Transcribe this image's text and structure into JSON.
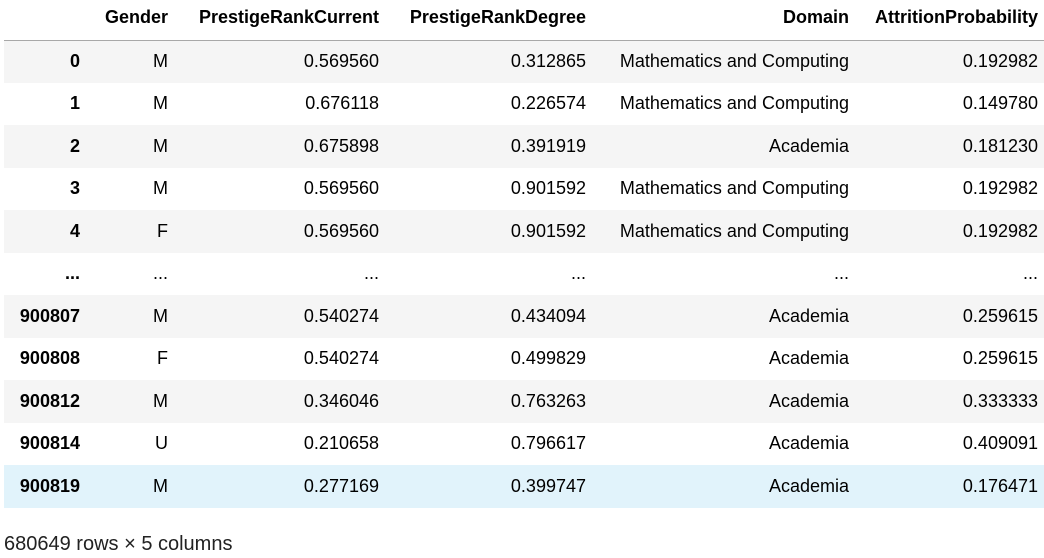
{
  "table": {
    "columns": [
      "",
      "Gender",
      "PrestigeRankCurrent",
      "PrestigeRankDegree",
      "Domain",
      "AttritionProbability"
    ],
    "rows": [
      {
        "index": "0",
        "gender": "M",
        "current": "0.569560",
        "degree": "0.312865",
        "domain": "Mathematics and Computing",
        "attrition": "0.192982"
      },
      {
        "index": "1",
        "gender": "M",
        "current": "0.676118",
        "degree": "0.226574",
        "domain": "Mathematics and Computing",
        "attrition": "0.149780"
      },
      {
        "index": "2",
        "gender": "M",
        "current": "0.675898",
        "degree": "0.391919",
        "domain": "Academia",
        "attrition": "0.181230"
      },
      {
        "index": "3",
        "gender": "M",
        "current": "0.569560",
        "degree": "0.901592",
        "domain": "Mathematics and Computing",
        "attrition": "0.192982"
      },
      {
        "index": "4",
        "gender": "F",
        "current": "0.569560",
        "degree": "0.901592",
        "domain": "Mathematics and Computing",
        "attrition": "0.192982"
      },
      {
        "index": "...",
        "gender": "...",
        "current": "...",
        "degree": "...",
        "domain": "...",
        "attrition": "..."
      },
      {
        "index": "900807",
        "gender": "M",
        "current": "0.540274",
        "degree": "0.434094",
        "domain": "Academia",
        "attrition": "0.259615"
      },
      {
        "index": "900808",
        "gender": "F",
        "current": "0.540274",
        "degree": "0.499829",
        "domain": "Academia",
        "attrition": "0.259615"
      },
      {
        "index": "900812",
        "gender": "M",
        "current": "0.346046",
        "degree": "0.763263",
        "domain": "Academia",
        "attrition": "0.333333"
      },
      {
        "index": "900814",
        "gender": "U",
        "current": "0.210658",
        "degree": "0.796617",
        "domain": "Academia",
        "attrition": "0.409091"
      },
      {
        "index": "900819",
        "gender": "M",
        "current": "0.277169",
        "degree": "0.399747",
        "domain": "Academia",
        "attrition": "0.176471"
      }
    ]
  },
  "footer": "680649 rows × 5 columns",
  "colors": {
    "row_odd": "#f5f5f5",
    "row_even": "#ffffff",
    "row_hover": "#e1f3fb",
    "header_border": "#a8a8a8"
  }
}
